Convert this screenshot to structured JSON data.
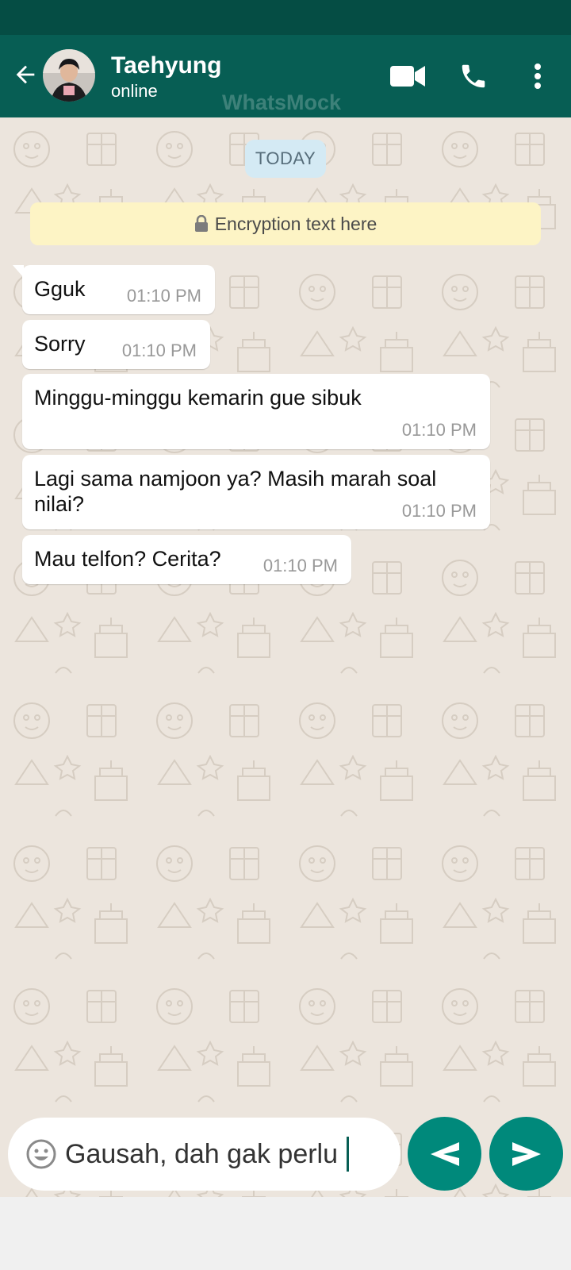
{
  "header": {
    "contact_name": "Taehyung",
    "contact_status": "online",
    "watermark": "WhatsMock",
    "icons": [
      "back-arrow-icon",
      "video-call-icon",
      "phone-call-icon",
      "more-vert-icon"
    ]
  },
  "chat": {
    "date_label": "TODAY",
    "encryption_text": "Encryption text here",
    "messages": [
      {
        "text": "Gguk",
        "time": "01:10 PM"
      },
      {
        "text": "Sorry",
        "time": "01:10 PM"
      },
      {
        "text": "Minggu-minggu kemarin gue sibuk",
        "time": "01:10 PM"
      },
      {
        "text": "Lagi sama namjoon ya? Masih marah soal nilai?",
        "time": "01:10 PM"
      },
      {
        "text": "Mau telfon? Cerita?",
        "time": "01:10 PM"
      }
    ]
  },
  "composer": {
    "input_value": "Gausah, dah gak perlu"
  },
  "colors": {
    "header": "#075e54",
    "status_bar": "#054d44",
    "accent": "#00897b",
    "chat_background": "#ece5dd",
    "encryption_bg": "#fdf4c5",
    "date_chip_bg": "#d4eaf4"
  }
}
